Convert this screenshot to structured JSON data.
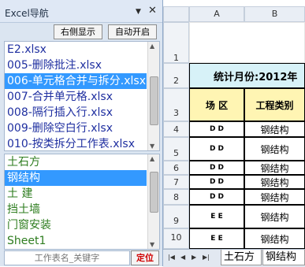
{
  "pane": {
    "title": "Excel导航",
    "dropdown_icon": "▼",
    "close_icon": "✕",
    "btn_right": "右侧显示",
    "btn_auto": "自动开启",
    "files": [
      "E2.xlsx",
      "005-删除批注.xlsx",
      "006-单元格合并与拆分.xlsx",
      "007-合并单元格.xlsx",
      "008-隔行插入行.xlsx",
      "009-删除空白行.xlsx",
      "010-按类拆分工作表.xlsx"
    ],
    "selected_file_index": 2,
    "sheets": [
      "土石方",
      "钢结构",
      "土 建",
      "挡土墙",
      "门窗安装",
      "Sheet1"
    ],
    "selected_sheet_index": 1,
    "search_placeholder": "工作表名_关键字",
    "btn_locate": "定位"
  },
  "sheet": {
    "col_headers": [
      "A",
      "B"
    ],
    "row_headers": [
      "1",
      "2",
      "3",
      "4",
      "5",
      "6",
      "7",
      "8",
      "9",
      "10"
    ],
    "title": "统计月份:2012年",
    "header_a": "场 区",
    "header_b": "工程类别",
    "col_a": [
      "D D",
      "D D",
      "D D",
      "D D",
      "D D",
      "E E",
      "E E"
    ],
    "col_b": [
      "钢结构",
      "钢结构",
      "钢结构",
      "钢结构",
      "钢结构",
      "钢结构",
      "钢结构"
    ],
    "tabs": [
      "土石方",
      "钢结构"
    ],
    "nav_icons": [
      "|◀",
      "◀",
      "▶",
      "▶|"
    ]
  },
  "colors": {
    "selection": "#3399ff",
    "file_text": "#1f2fa0",
    "sheet_text": "#2e7d1f",
    "title_fill": "#d7f2f8",
    "header_fill": "#fff5b3"
  }
}
